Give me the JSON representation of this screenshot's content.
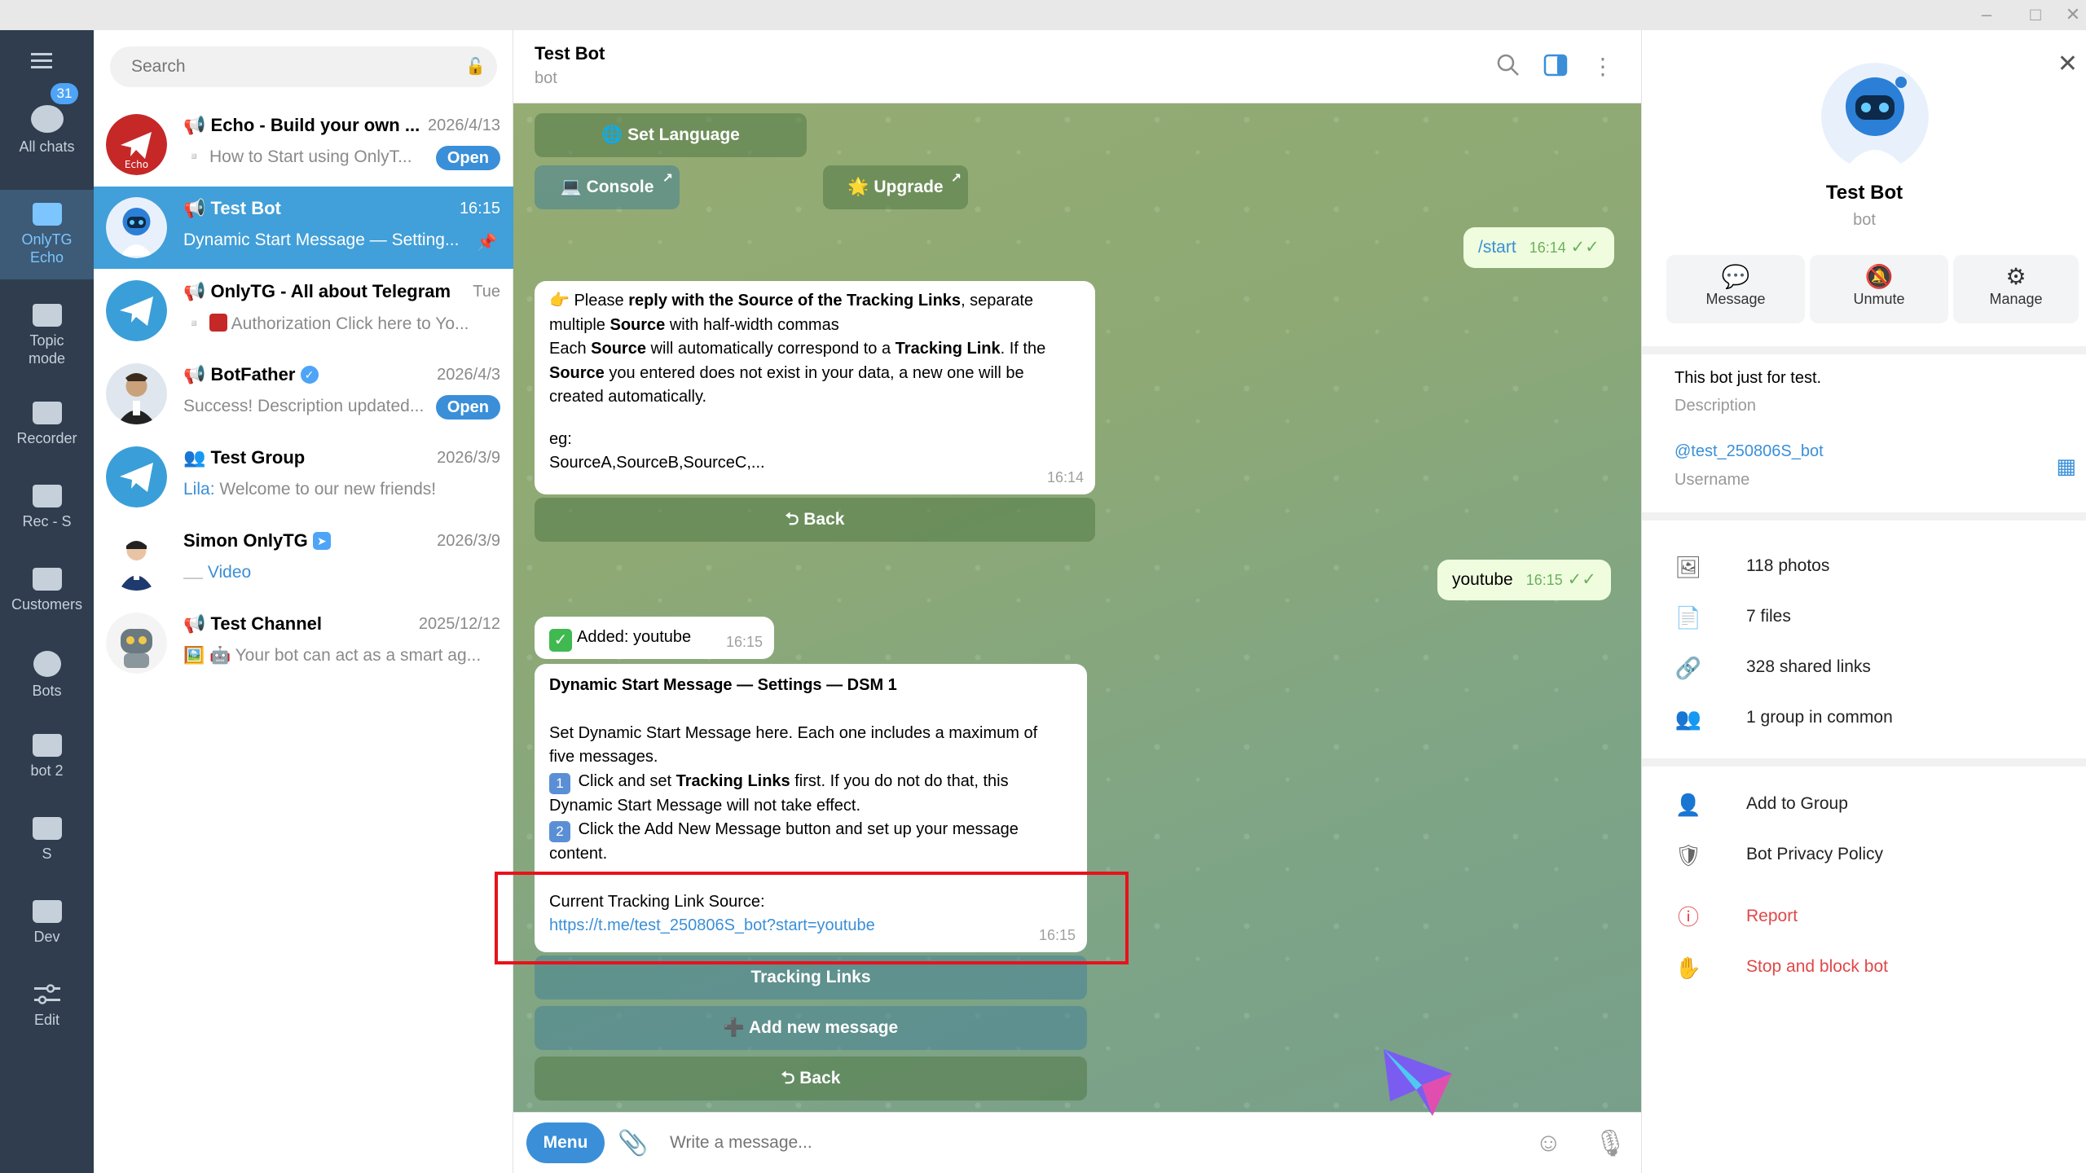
{
  "window": {
    "minimize": "–",
    "maximize": "□",
    "close": "✕"
  },
  "folders": [
    {
      "label": "All chats",
      "icon": "chats-icon"
    },
    {
      "label": "OnlyTG\nEcho",
      "icon": "folder-icon",
      "active": true
    },
    {
      "label": "Topic\nmode",
      "icon": "folder-icon"
    },
    {
      "label": "Recorder",
      "icon": "folder-icon"
    },
    {
      "label": "Rec - S",
      "icon": "folder-icon"
    },
    {
      "label": "Customers",
      "icon": "folder-icon"
    },
    {
      "label": "Bots",
      "icon": "bot-icon"
    },
    {
      "label": "bot 2",
      "icon": "folder-icon"
    },
    {
      "label": "S",
      "icon": "folder-icon"
    },
    {
      "label": "Dev",
      "icon": "folder-icon"
    },
    {
      "label": "Edit",
      "icon": "edit-icon"
    }
  ],
  "all_chats_badge": "31",
  "search": {
    "placeholder": "Search"
  },
  "chats": [
    {
      "title": "Echo - Build your own ...",
      "time": "2026/4/13",
      "preview": "How to Start using OnlyT...",
      "open": "Open"
    },
    {
      "title": "Test Bot",
      "time": "16:15",
      "preview": "Dynamic Start Message — Setting...",
      "active": true
    },
    {
      "title": "OnlyTG - All about Telegram",
      "time": "Tue",
      "preview": "Authorization Click here to Yo..."
    },
    {
      "title": "BotFather",
      "time": "2026/4/3",
      "preview": "Success! Description updated...",
      "open": "Open"
    },
    {
      "title": "Test Group",
      "time": "2026/3/9",
      "preview_sender": "Lila:",
      "preview": "Welcome to our new friends!"
    },
    {
      "title": "Simon OnlyTG",
      "time": "2026/3/9",
      "preview": "Video"
    },
    {
      "title": "Test Channel",
      "time": "2025/12/12",
      "preview": "Your bot can act as a smart ag..."
    }
  ],
  "header": {
    "name": "Test Bot",
    "sub": "bot"
  },
  "keyboard_top": {
    "set_language": "Set Language",
    "console": "Console",
    "upgrade": "Upgrade"
  },
  "messages": {
    "start_cmd": "/start",
    "start_time": "16:14",
    "source_msg": {
      "line1_pre": "Please ",
      "line1_bold": "reply with the Source of the Tracking Links",
      "line1_post": ", separate",
      "line2_pre": "multiple ",
      "line2_bold": "Source",
      "line2_post": " with half-width commas",
      "line3_pre": "Each ",
      "line3_bold": "Source",
      "line3_mid": " will automatically correspond to a ",
      "line3_bold2": "Tracking Link",
      "line3_post": ". If the",
      "line4_bold": "Source",
      "line4_post": " you entered does not exist in your data, a new one will be",
      "line5": "created automatically.",
      "line6": "eg:",
      "line7": "SourceA,SourceB,SourceC,...",
      "time": "16:14"
    },
    "back_label": "Back",
    "youtube": "youtube",
    "youtube_time": "16:15",
    "added": "Added: youtube",
    "added_time": "16:15",
    "dsm": {
      "title": "Dynamic Start Message — Settings — DSM 1",
      "p1": "Set Dynamic Start Message here. Each one includes a maximum of",
      "p1b": "five messages.",
      "s1_pre": "Click and set ",
      "s1_bold": "Tracking Links",
      "s1_post": " first. If you do not do that, this",
      "s1b": "Dynamic Start Message will not take effect.",
      "s2": "Click the Add New Message button and set up your message",
      "s2b": "content.",
      "current": "Current Tracking Link Source:",
      "link": "https://t.me/test_250806S_bot?start=youtube",
      "time": "16:15",
      "n1": "1",
      "n2": "2"
    },
    "tracking_links": "Tracking Links",
    "add_new_message": "Add new message",
    "back2": "Back"
  },
  "composer": {
    "menu": "Menu",
    "placeholder": "Write a message..."
  },
  "profile": {
    "name": "Test Bot",
    "sub": "bot",
    "actions": [
      {
        "label": "Message"
      },
      {
        "label": "Unmute"
      },
      {
        "label": "Manage"
      }
    ],
    "description": "This bot just for test.",
    "description_label": "Description",
    "username": "@test_250806S_bot",
    "username_label": "Username",
    "media": [
      "118 photos",
      "7 files",
      "328 shared links",
      "1 group in common"
    ],
    "actions2": [
      "Add to Group",
      "Bot Privacy Policy"
    ],
    "danger": [
      "Report",
      "Stop and block bot"
    ]
  }
}
